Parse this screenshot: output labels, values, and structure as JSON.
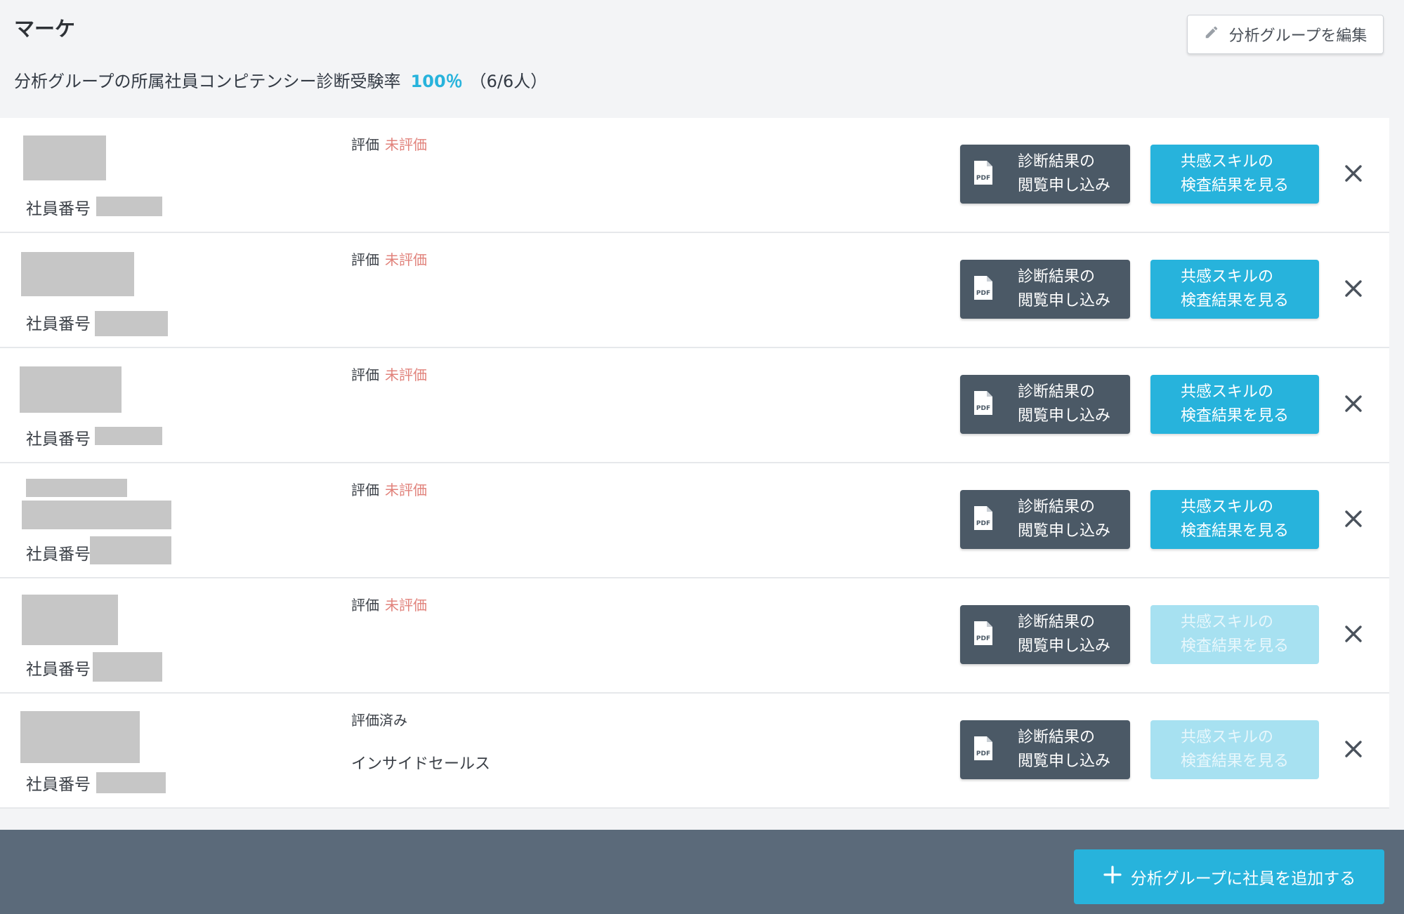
{
  "header": {
    "group_title": "マーケ",
    "edit_button_label": "分析グループを編集",
    "rate_label": "分析グループの所属社員コンピテンシー診断受験率",
    "rate_value": "100％",
    "rate_count": "（6/6人）"
  },
  "labels": {
    "employee_number": "社員番号",
    "evaluation": "評価",
    "pdf_button": "診断結果の\n閲覧申し込み",
    "skill_button": "共感スキルの\n検査結果を見る"
  },
  "rows": [
    {
      "eval_status": "未評価",
      "skill_enabled": true
    },
    {
      "eval_status": "未評価",
      "skill_enabled": true
    },
    {
      "eval_status": "未評価",
      "skill_enabled": true
    },
    {
      "eval_status": "未評価",
      "skill_enabled": true
    },
    {
      "eval_status": "未評価",
      "skill_enabled": false
    },
    {
      "eval_status": "評価済み",
      "department": "インサイドセールス",
      "skill_enabled": false
    }
  ],
  "footer": {
    "add_button_label": "分析グループに社員を追加する"
  },
  "colors": {
    "accent": "#27b3dc",
    "accent_disabled": "#a7e1f1",
    "dark_button": "#4b5966",
    "unevaluated": "#e1827b",
    "footer_bg": "#5b6a7a"
  },
  "icons": [
    "pencil-icon",
    "pdf-file-icon",
    "close-icon",
    "plus-icon"
  ]
}
